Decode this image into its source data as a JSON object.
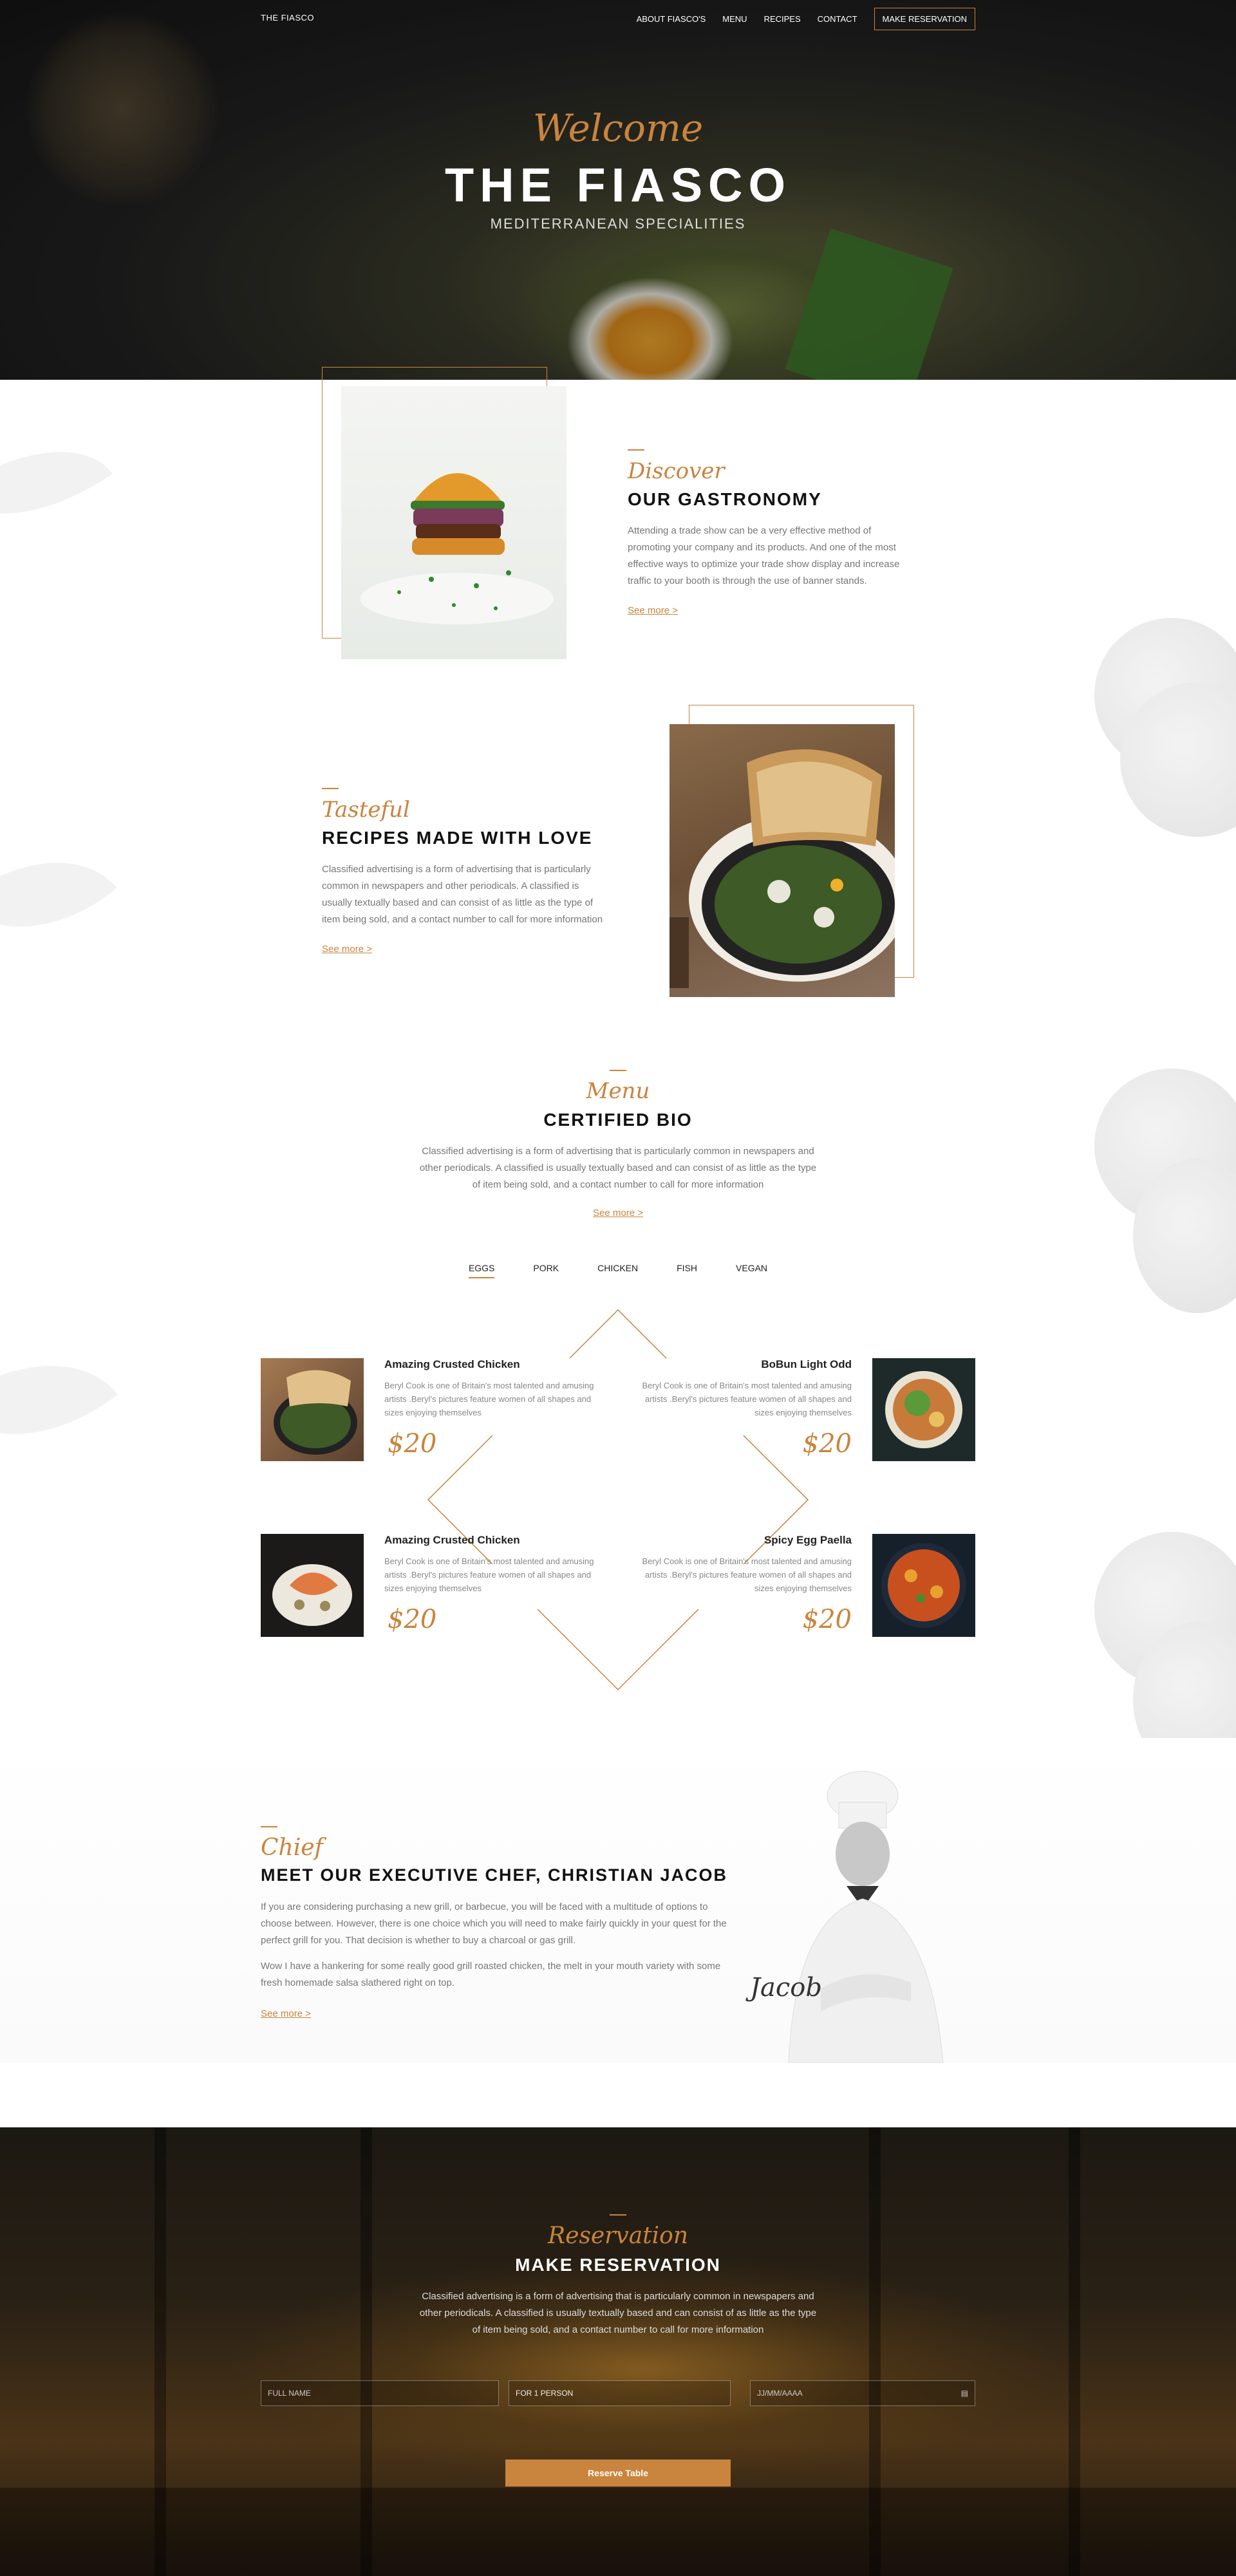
{
  "nav": {
    "brand": "THE FIASCO",
    "links": [
      "ABOUT FIASCO'S",
      "MENU",
      "RECIPES",
      "CONTACT"
    ],
    "reserve": "MAKE RESERVATION"
  },
  "hero": {
    "script": "Welcome",
    "title": "THE FIASCO",
    "subtitle": "MEDITERRANEAN SPECIALITIES"
  },
  "discover": {
    "script": "Discover",
    "title": "OUR GASTRONOMY",
    "text": "Attending a trade show can be a very effective method of promoting your company and its products. And one of the most effective ways to optimize your trade show display and increase traffic to your booth is through the use of banner stands.",
    "link": "See more >"
  },
  "tasteful": {
    "script": "Tasteful",
    "title": "RECIPES MADE WITH LOVE",
    "text": "Classified advertising is a form of advertising that is particularly common in newspapers and other periodicals. A classified is usually textually based and can consist of as little as the type of item being sold, and a contact number to call for more information",
    "link": "See more >"
  },
  "menu": {
    "script": "Menu",
    "title": "CERTIFIED BIO",
    "text": "Classified advertising is a form of advertising that is particularly common in newspapers and other periodicals. A classified is usually textually based and can consist of as little as the type of item being sold, and a contact number to call for more information",
    "link": "See more >",
    "tabs": [
      "EGGS",
      "PORK",
      "CHICKEN",
      "FISH",
      "VEGAN"
    ],
    "active_tab": "EGGS",
    "items": [
      {
        "name": "Amazing Crusted Chicken",
        "desc": "Beryl Cook is one of Britain's most talented and amusing artists .Beryl's pictures feature women of all shapes and sizes enjoying themselves",
        "price": "$20"
      },
      {
        "name": "BoBun Light Odd",
        "desc": "Beryl Cook is one of Britain's most talented and amusing artists .Beryl's pictures feature women of all shapes and sizes enjoying themselves",
        "price": "$20"
      },
      {
        "name": "Amazing Crusted Chicken",
        "desc": "Beryl Cook is one of Britain's most talented and amusing artists .Beryl's pictures feature women of all shapes and sizes enjoying themselves",
        "price": "$20"
      },
      {
        "name": "Spicy Egg Paella",
        "desc": "Beryl Cook is one of Britain's most talented and amusing artists .Beryl's pictures feature women of all shapes and sizes enjoying themselves",
        "price": "$20"
      }
    ]
  },
  "chef": {
    "script": "Chief",
    "title": "MEET OUR EXECUTIVE CHEF, CHRISTIAN JACOB",
    "text1": "If you are considering purchasing a new grill, or barbecue, you will be faced with a multitude of options to choose between. However, there is one choice which you will need to make fairly quickly in your quest for the perfect grill for you. That decision is whether to buy a charcoal or gas grill.",
    "text2": "Wow I have a hankering for some really good grill roasted chicken, the melt in your mouth variety with some fresh homemade salsa slathered right on top.",
    "link": "See more >",
    "signature": "Jacob"
  },
  "reservation": {
    "script": "Reservation",
    "title": "MAKE RESERVATION",
    "text": "Classified advertising is a form of advertising that is particularly common in newspapers and other periodicals. A classified is usually textually based and can consist of as little as the type of item being sold, and a contact number to call for more information",
    "name_placeholder": "FULL NAME",
    "persons_value": "FOR 1 PERSON",
    "date_placeholder": "JJ/MM/AAAA",
    "button": "Reserve Table"
  },
  "colors": {
    "accent": "#c9843d",
    "text": "#777777",
    "heading": "#111111"
  }
}
